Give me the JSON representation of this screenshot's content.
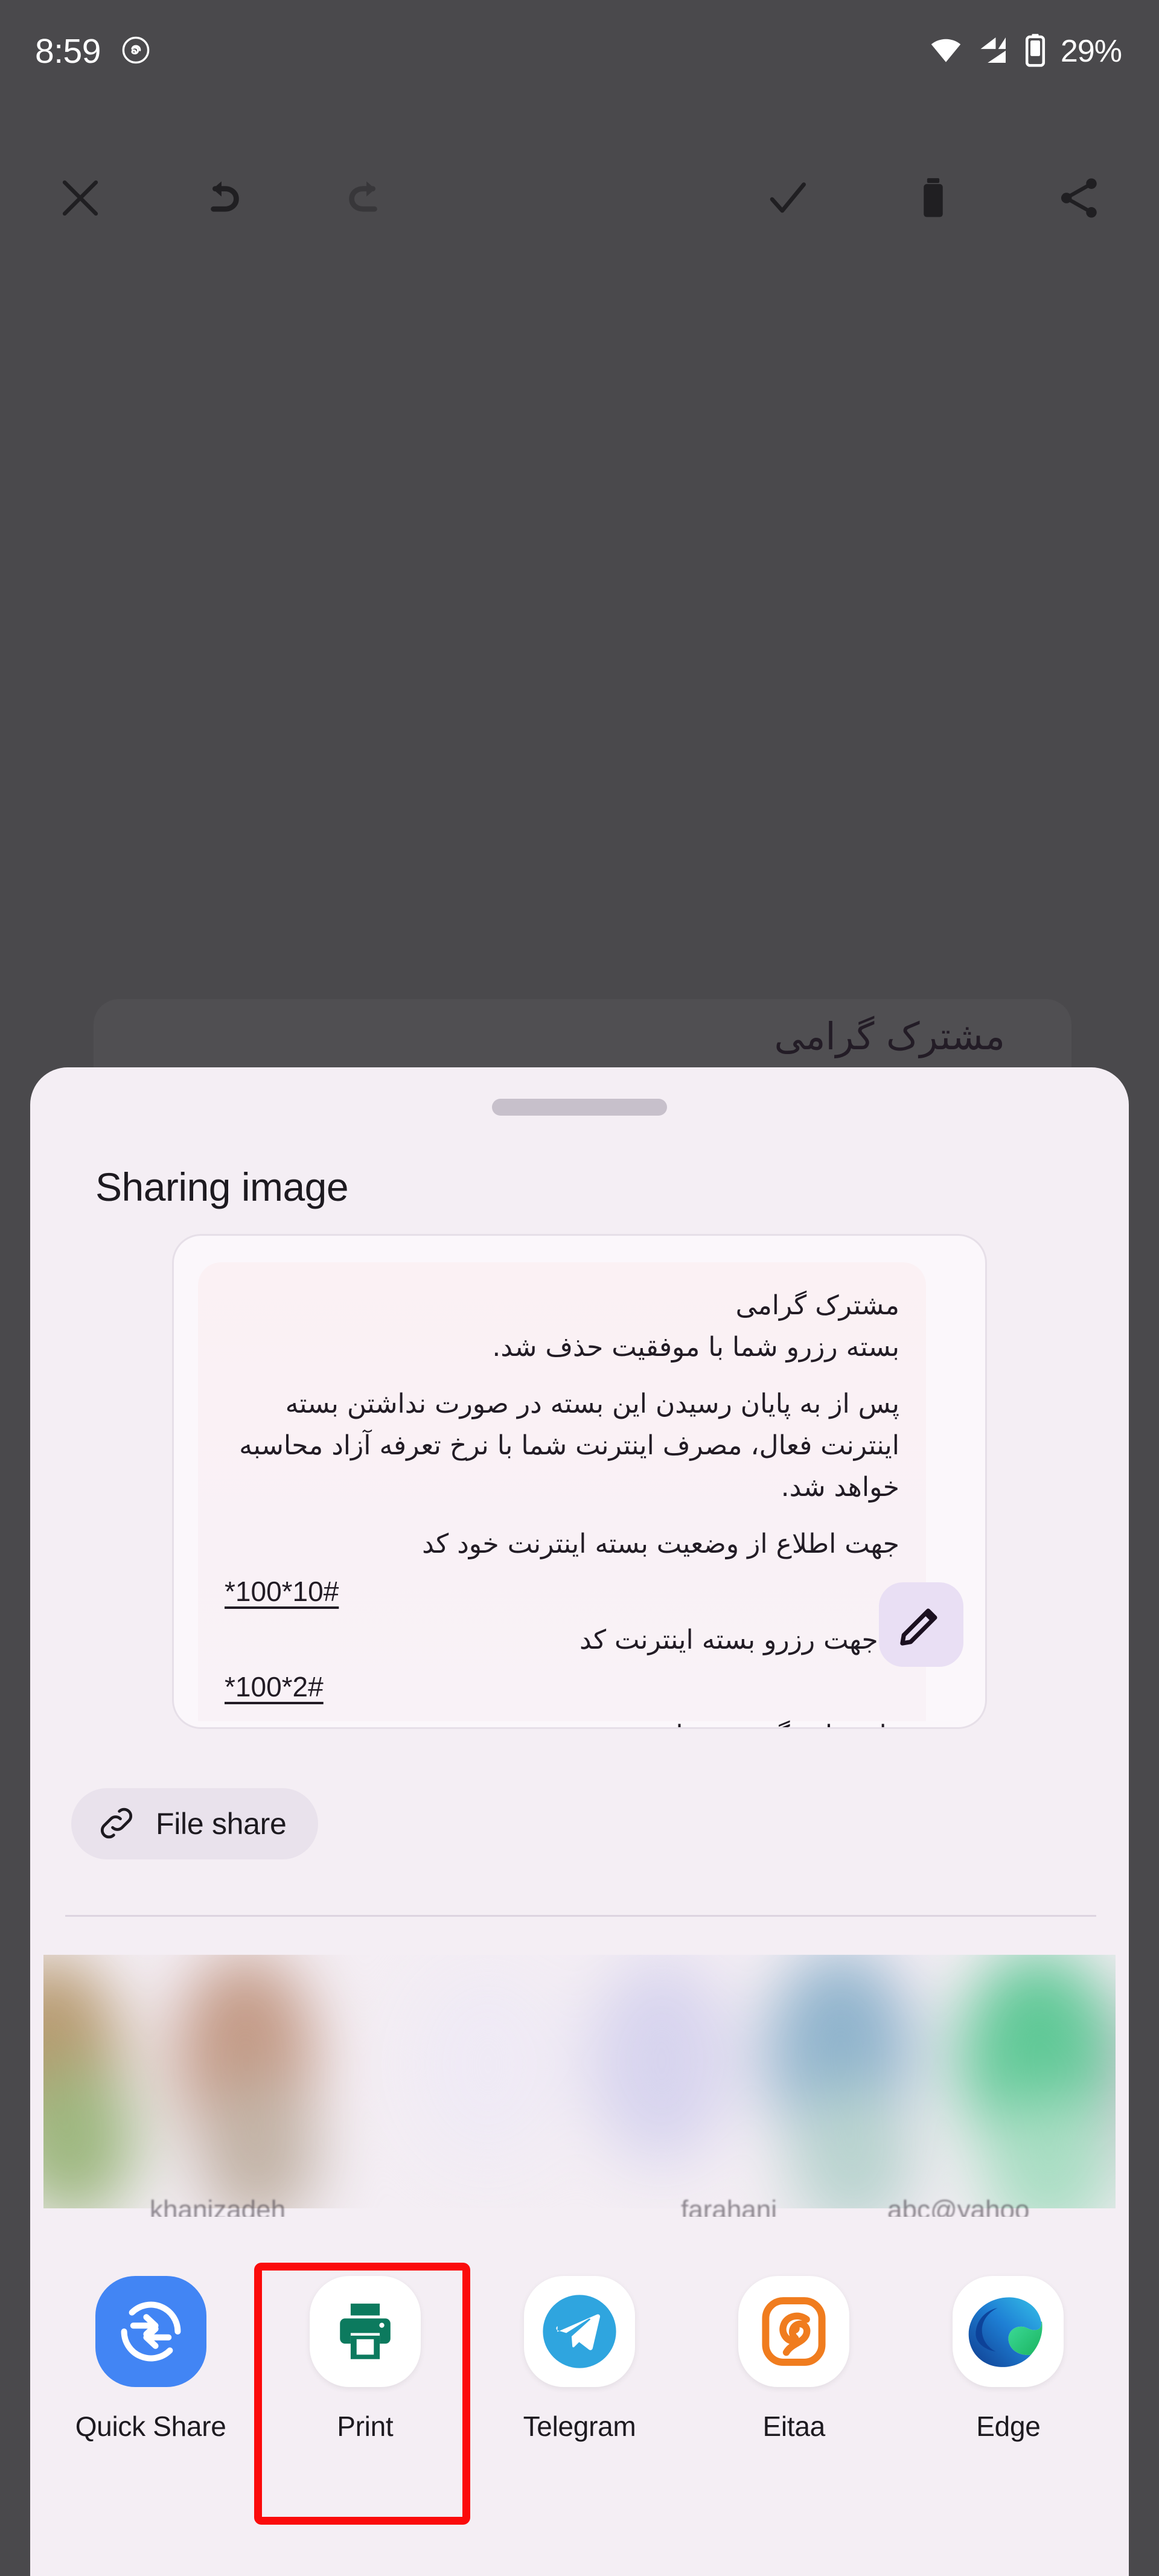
{
  "status_bar": {
    "clock": "8:59",
    "battery_percent": "29%",
    "icons": {
      "app_notification": "threads-icon",
      "wifi": "wifi-icon",
      "cellular": "cellular-signal-icon",
      "battery": "battery-icon"
    }
  },
  "editor_toolbar": {
    "close_label": "close-icon",
    "undo_label": "undo-icon",
    "redo_label": "redo-icon",
    "confirm_label": "check-icon",
    "delete_label": "trash-icon",
    "share_label": "share-icon",
    "redo_disabled": true
  },
  "backdrop": {
    "partial_text": "مشترک گرامی"
  },
  "sheet": {
    "title": "Sharing image",
    "drag_handle": "drag-handle"
  },
  "preview": {
    "edit_button_label": "edit-pencil-icon",
    "sms_lines": [
      "مشترک گرامی",
      "بسته رزرو شما با موفقیت حذف شد.",
      "پس از به پایان رسیدن این بسته در صورت نداشتن بسته اینترنت فعال، مصرف اینترنت شما با نرخ تعرفه آزاد محاسبه خواهد شد.",
      "جهت اطلاع از وضعیت بسته اینترنت خود کد"
    ],
    "ussd_status_code": "*100*10#",
    "sms_line_reserve": "و جهت رزرو بسته اینترنت کد",
    "ussd_reserve_code": "*100*2#",
    "sms_line_final": "را شماره گیری فرمایید."
  },
  "file_share_chip": {
    "label": "File share",
    "icon": "link-chain-icon"
  },
  "contacts_strip": {
    "blurred": true,
    "names": [
      "khanizadeh",
      "farahani",
      "abc@yahoo"
    ]
  },
  "app_targets": [
    {
      "label": "Quick Share",
      "icon": "quick-share-icon",
      "bg": "#4285f4"
    },
    {
      "label": "Print",
      "icon": "printer-icon",
      "bg": "#ffffff"
    },
    {
      "label": "Telegram",
      "icon": "telegram-icon",
      "bg": "#ffffff"
    },
    {
      "label": "Eitaa",
      "icon": "eitaa-icon",
      "bg": "#ffffff"
    },
    {
      "label": "Edge",
      "icon": "edge-icon",
      "bg": "#ffffff"
    }
  ],
  "annotation": {
    "type": "highlight-rectangle",
    "color": "#fb0b0b",
    "targets": "Print"
  },
  "colors": {
    "backdrop_scrim": "#4a494c",
    "sheet_background": "#f4eef4",
    "preview_card": "#fbf7fb",
    "chip_background": "#e9e2ec",
    "accent_print_green": "#0c7a5e",
    "accent_quick_share_blue": "#4285f4",
    "accent_telegram_blue": "#2fa5df",
    "accent_eitaa_orange": "#f07c1e",
    "annotation_red": "#fb0b0b",
    "text_primary": "#1d1a20"
  }
}
